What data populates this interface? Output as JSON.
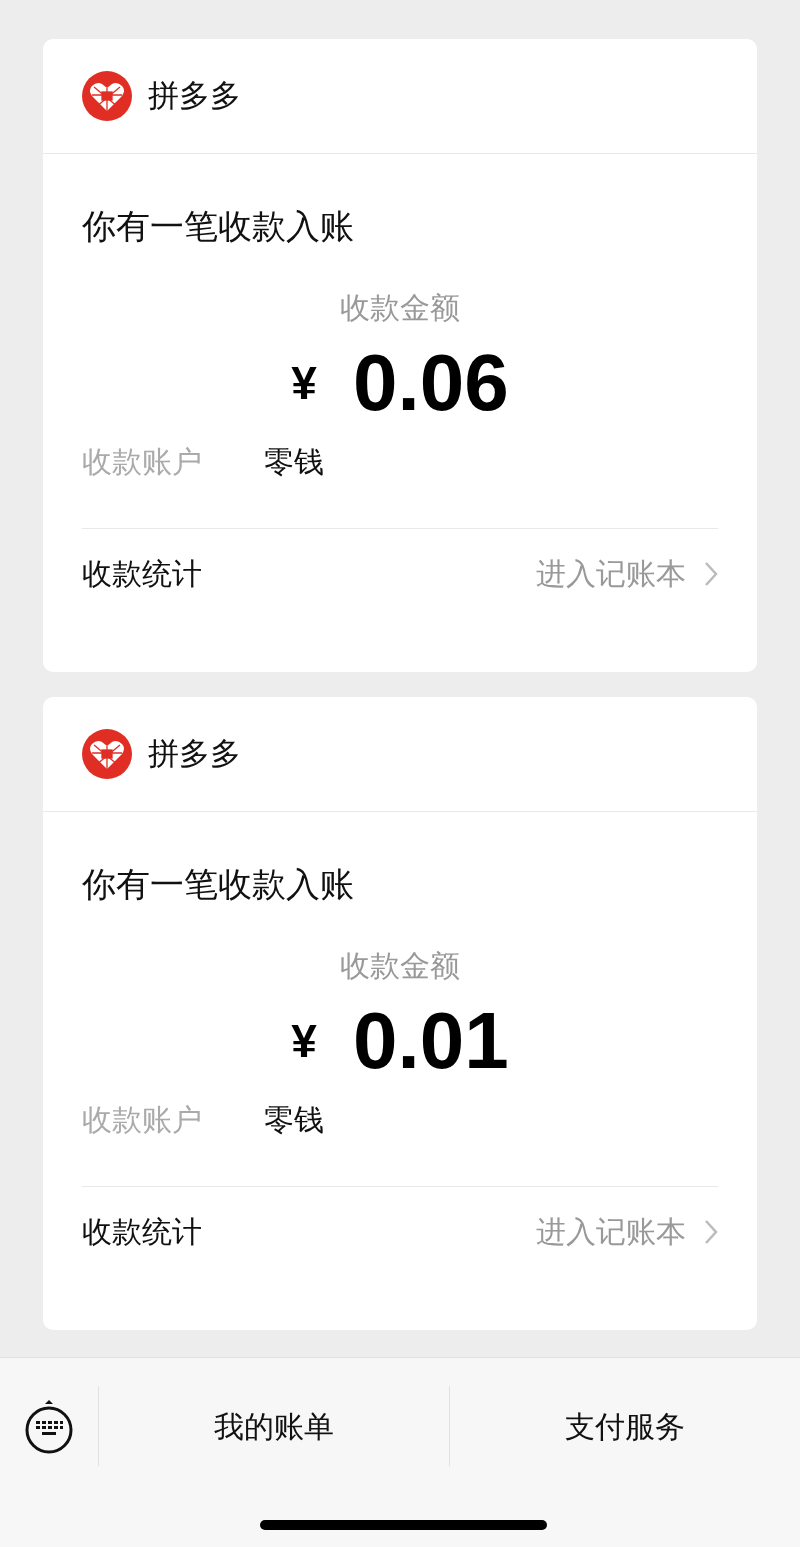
{
  "messages": [
    {
      "sender": "拼多多",
      "title": "你有一笔收款入账",
      "amount_label": "收款金额",
      "currency": "¥",
      "amount": "0.06",
      "account_label": "收款账户",
      "account": "零钱",
      "stats_label": "收款统计",
      "stats_link": "进入记账本"
    },
    {
      "sender": "拼多多",
      "title": "你有一笔收款入账",
      "amount_label": "收款金额",
      "currency": "¥",
      "amount": "0.01",
      "account_label": "收款账户",
      "account": "零钱",
      "stats_label": "收款统计",
      "stats_link": "进入记账本"
    }
  ],
  "bottom_menu": [
    "我的账单",
    "支付服务"
  ]
}
